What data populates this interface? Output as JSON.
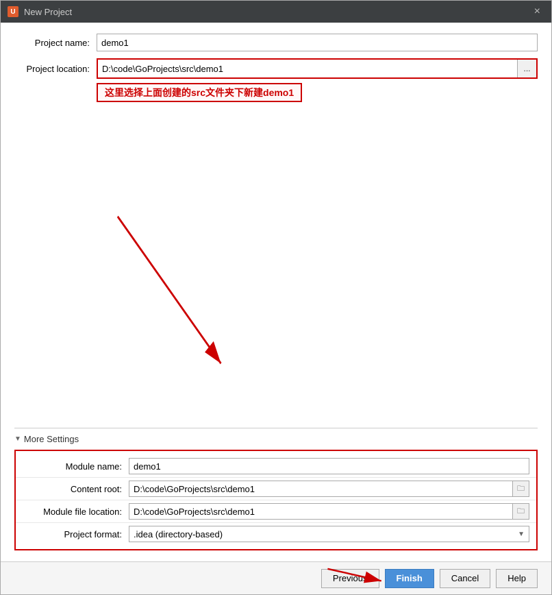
{
  "window": {
    "title": "New Project",
    "icon": "U",
    "close_label": "×"
  },
  "form": {
    "project_name_label": "Project name:",
    "project_name_value": "demo1",
    "project_location_label": "Project location:",
    "project_location_value": "D:\\code\\GoProjects\\src\\demo1",
    "browse_label": "...",
    "annotation_text": "这里选择上面创建的src文件夹下新建demo1"
  },
  "more_settings": {
    "header_label": "More Settings",
    "expand_icon": "▼",
    "module_name_label": "Module name:",
    "module_name_value": "demo1",
    "content_root_label": "Content root:",
    "content_root_value": "D:\\code\\GoProjects\\src\\demo1",
    "module_file_label": "Module file location:",
    "module_file_value": "D:\\code\\GoProjects\\src\\demo1",
    "project_format_label": "Project format:",
    "project_format_value": ".idea (directory-based)",
    "browse_icon": "📁"
  },
  "footer": {
    "previous_label": "Previous",
    "finish_label": "Finish",
    "cancel_label": "Cancel",
    "help_label": "Help"
  }
}
